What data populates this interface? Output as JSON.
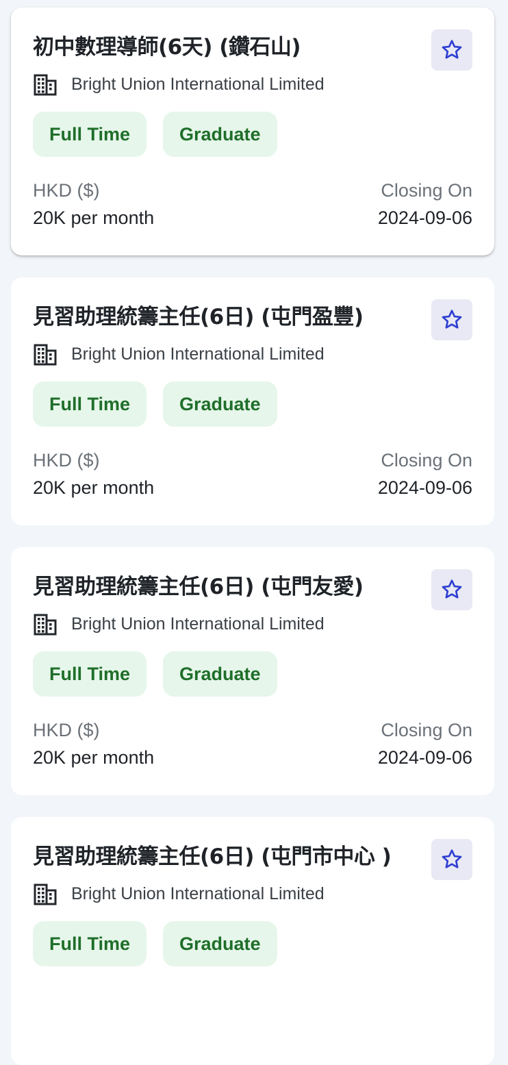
{
  "colors": {
    "page_background": "#f2f5f9",
    "card_background": "#ffffff",
    "star_button_bg": "#e8e9f4",
    "star_icon": "#2f3fd1",
    "chip_bg": "#e6f6ea",
    "chip_text": "#1f6e2a",
    "muted_text": "#6b7178"
  },
  "jobs": [
    {
      "title": "初中數理導師(6天) (鑽石山)",
      "company": "Bright Union International Limited",
      "company_icon": "building-icon",
      "favorite_icon": "star-outline-icon",
      "tags": [
        "Full Time",
        "Graduate"
      ],
      "currency_label": "HKD ($)",
      "salary": "20K per month",
      "closing_label": "Closing On",
      "closing_date": "2024-09-06"
    },
    {
      "title": "見習助理統籌主任(6日) (屯門盈豐)",
      "company": "Bright Union International Limited",
      "company_icon": "building-icon",
      "favorite_icon": "star-outline-icon",
      "tags": [
        "Full Time",
        "Graduate"
      ],
      "currency_label": "HKD ($)",
      "salary": "20K per month",
      "closing_label": "Closing On",
      "closing_date": "2024-09-06"
    },
    {
      "title": "見習助理統籌主任(6日) (屯門友愛)",
      "company": "Bright Union International Limited",
      "company_icon": "building-icon",
      "favorite_icon": "star-outline-icon",
      "tags": [
        "Full Time",
        "Graduate"
      ],
      "currency_label": "HKD ($)",
      "salary": "20K per month",
      "closing_label": "Closing On",
      "closing_date": "2024-09-06"
    },
    {
      "title": "見習助理統籌主任(6日) (屯門市中心 )",
      "company": "Bright Union International Limited",
      "company_icon": "building-icon",
      "favorite_icon": "star-outline-icon",
      "tags": [
        "Full Time",
        "Graduate"
      ]
    }
  ]
}
